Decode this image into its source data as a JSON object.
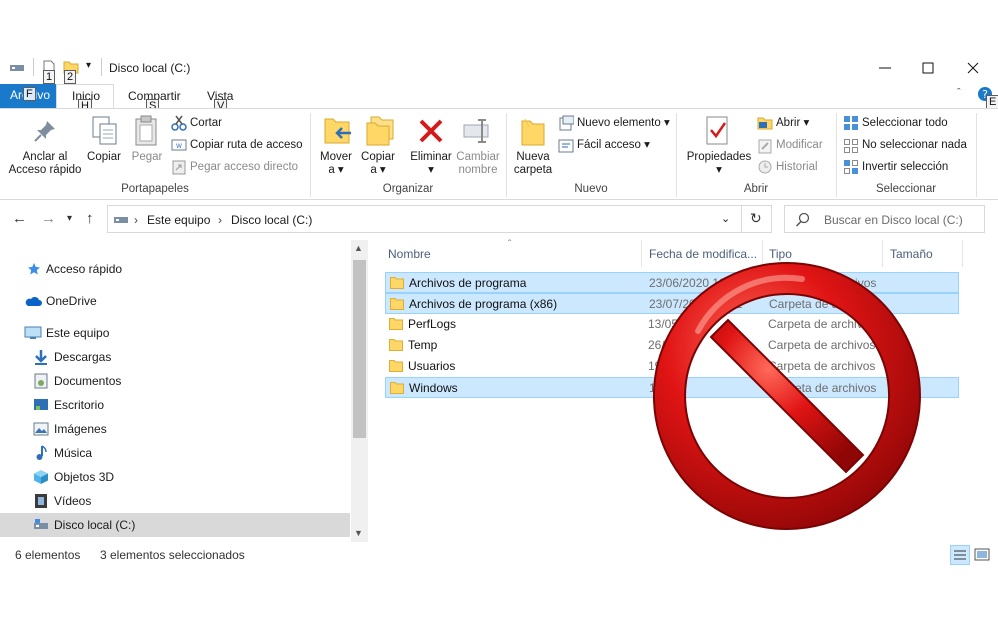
{
  "window": {
    "title": "Disco local (C:)",
    "keytips": {
      "qa1": "1",
      "qa2": "2",
      "file": "F",
      "home": "H",
      "share": "S",
      "view": "V",
      "help": "E"
    }
  },
  "ribbon_tabs": {
    "file": "Archivo",
    "home": "Inicio",
    "share": "Compartir",
    "view": "Vista"
  },
  "ribbon": {
    "clipboard": {
      "label": "Portapapeles",
      "pin_line1": "Anclar al",
      "pin_line2": "Acceso rápido",
      "copy": "Copiar",
      "paste": "Pegar",
      "cut": "Cortar",
      "copy_path": "Copiar ruta de acceso",
      "paste_shortcut": "Pegar acceso directo"
    },
    "organize": {
      "label": "Organizar",
      "move_line1": "Mover",
      "move_line2": "a ▾",
      "copyto_line1": "Copiar",
      "copyto_line2": "a ▾",
      "delete_line1": "Eliminar",
      "delete_line2": "▾",
      "rename_line1": "Cambiar",
      "rename_line2": "nombre"
    },
    "new": {
      "label": "Nuevo",
      "folder_line1": "Nueva",
      "folder_line2": "carpeta",
      "new_item": "Nuevo elemento ▾",
      "easy_access": "Fácil acceso ▾"
    },
    "open": {
      "label": "Abrir",
      "props_line1": "Propiedades",
      "props_line2": "▾",
      "open": "Abrir ▾",
      "edit": "Modificar",
      "history": "Historial"
    },
    "select": {
      "label": "Seleccionar",
      "all": "Seleccionar todo",
      "none": "No seleccionar nada",
      "invert": "Invertir selección"
    }
  },
  "address": {
    "crumb1": "Este equipo",
    "crumb2": "Disco local (C:)",
    "search_placeholder": "Buscar en Disco local (C:)"
  },
  "nav_pane": [
    {
      "label": "Acceso rápido",
      "icon": "star-icon"
    },
    {
      "label": "OneDrive",
      "icon": "cloud-icon"
    },
    {
      "label": "Este equipo",
      "icon": "computer-icon"
    },
    {
      "label": "Descargas",
      "icon": "download-icon"
    },
    {
      "label": "Documentos",
      "icon": "documents-icon"
    },
    {
      "label": "Escritorio",
      "icon": "desktop-icon"
    },
    {
      "label": "Imágenes",
      "icon": "pictures-icon"
    },
    {
      "label": "Música",
      "icon": "music-icon"
    },
    {
      "label": "Objetos 3D",
      "icon": "cube-icon"
    },
    {
      "label": "Vídeos",
      "icon": "video-icon"
    },
    {
      "label": "Disco local (C:)",
      "icon": "drive-icon"
    }
  ],
  "columns": {
    "name": "Nombre",
    "date": "Fecha de modifica...",
    "type": "Tipo",
    "size": "Tamaño"
  },
  "files": [
    {
      "name": "Archivos de programa",
      "date": "23/06/2020 12:06",
      "type": "Carpeta de archivos"
    },
    {
      "name": "Archivos de programa (x86)",
      "date": "23/07/2020 10:52",
      "type": "Carpeta de archivos"
    },
    {
      "name": "PerfLogs",
      "date": "13/05/",
      "type": "Carpeta de archivos"
    },
    {
      "name": "Temp",
      "date": "26/0",
      "type": "Carpeta de archivos"
    },
    {
      "name": "Usuarios",
      "date": "19/",
      "type": "Carpeta de archivos"
    },
    {
      "name": "Windows",
      "date": "1",
      "type": "Carpeta de archivos"
    }
  ],
  "status": {
    "count": "6 elementos",
    "selected": "3 elementos seleccionados"
  },
  "colors": {
    "accent": "#1979ca",
    "selection": "#cce8ff",
    "folder": "#ffd766",
    "no_sign": "#d01010"
  }
}
